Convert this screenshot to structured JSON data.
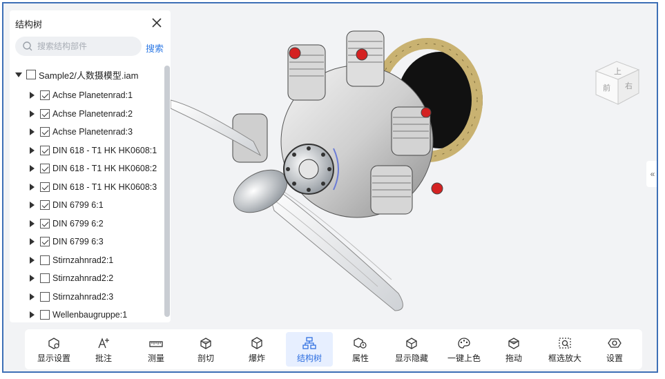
{
  "tree_panel": {
    "title": "结构树",
    "search": {
      "placeholder": "搜索结构部件",
      "button_label": "搜索"
    },
    "root": {
      "label": "Sample2/人数摄模型.iam",
      "checked": false
    },
    "items": [
      {
        "label": "Achse Planetenrad:1",
        "checked": true
      },
      {
        "label": "Achse Planetenrad:2",
        "checked": true
      },
      {
        "label": "Achse Planetenrad:3",
        "checked": true
      },
      {
        "label": "DIN 618 - T1 HK HK0608:1",
        "checked": true
      },
      {
        "label": "DIN 618 - T1 HK HK0608:2",
        "checked": true
      },
      {
        "label": "DIN 618 - T1 HK HK0608:3",
        "checked": true
      },
      {
        "label": "DIN 6799 6:1",
        "checked": true
      },
      {
        "label": "DIN 6799 6:2",
        "checked": true
      },
      {
        "label": "DIN 6799 6:3",
        "checked": true
      },
      {
        "label": "Stirnzahnrad2:1",
        "checked": false
      },
      {
        "label": "Stirnzahnrad2:2",
        "checked": false
      },
      {
        "label": "Stirnzahnrad2:3",
        "checked": false
      },
      {
        "label": "Wellenbaugruppe:1",
        "checked": false
      }
    ]
  },
  "view_cube": {
    "top": "上",
    "front": "前",
    "right": "右"
  },
  "side_toggle": "«",
  "toolbar": {
    "items": [
      {
        "label": "显示设置",
        "icon": "display-settings-icon"
      },
      {
        "label": "批注",
        "icon": "annotation-icon"
      },
      {
        "label": "测量",
        "icon": "measure-icon"
      },
      {
        "label": "剖切",
        "icon": "section-icon"
      },
      {
        "label": "爆炸",
        "icon": "explode-icon"
      },
      {
        "label": "结构树",
        "icon": "structure-tree-icon",
        "active": true
      },
      {
        "label": "属性",
        "icon": "properties-icon"
      },
      {
        "label": "显示隐藏",
        "icon": "show-hide-icon"
      },
      {
        "label": "一键上色",
        "icon": "palette-icon"
      },
      {
        "label": "拖动",
        "icon": "drag-icon"
      },
      {
        "label": "框选放大",
        "icon": "box-zoom-icon"
      },
      {
        "label": "设置",
        "icon": "settings-icon"
      }
    ]
  },
  "colors": {
    "accent": "#2f7ae5",
    "frame": "#3d6fb6",
    "background": "#f2f3f5"
  }
}
